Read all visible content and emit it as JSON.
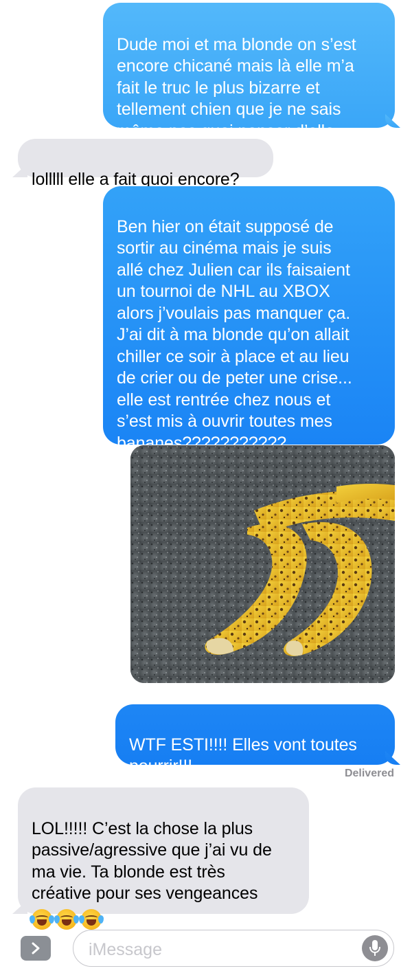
{
  "messages": [
    {
      "id": "msg1",
      "direction": "outgoing",
      "text": "Dude moi et ma blonde on s’est\nencore chicané mais là elle m’a\nfait le truc le plus bizarre et\ntellement chien que je ne sais\nmême pas quoi penser d’elle."
    },
    {
      "id": "msg2",
      "direction": "incoming",
      "text": "lolllll elle a fait quoi encore?"
    },
    {
      "id": "msg3",
      "direction": "outgoing",
      "text": "Ben hier on était supposé de\nsortir au cinéma mais je suis\nallé chez Julien car ils faisaient\nun tournoi de NHL au XBOX\nalors j’voulais pas manquer ça.\nJ’ai dit à ma blonde qu’on allait\nchiller ce soir à place et au lieu\nde crier ou de peter une crise...\nelle est rentrée chez nous et\ns’est mis à ouvrir toutes mes\nbananes???????????"
    },
    {
      "id": "msg4",
      "direction": "outgoing",
      "type": "image",
      "image_subject": "peeled-open-bananas-photo"
    },
    {
      "id": "msg5",
      "direction": "outgoing",
      "text": "WTF ESTI!!!! Elles vont toutes\npourrir!!!"
    },
    {
      "id": "msg6",
      "direction": "incoming",
      "text": "LOL!!!!! C’est la chose la plus\npassive/agressive que j’ai vu de\nma vie. Ta blonde est très\ncréative pour ses vengeances",
      "emojis": [
        "face-with-tears-of-joy",
        "face-with-tears-of-joy",
        "face-with-tears-of-joy"
      ]
    }
  ],
  "status": {
    "delivered": "Delivered"
  },
  "composer": {
    "placeholder": "iMessage",
    "apps_icon": "chevron-right-icon",
    "mic_icon": "microphone-icon"
  },
  "colors": {
    "outgoing_top": "#53b8fa",
    "outgoing_bottom": "#167ef3",
    "incoming": "#e5e5ea",
    "meta_gray": "#8e8e93"
  }
}
